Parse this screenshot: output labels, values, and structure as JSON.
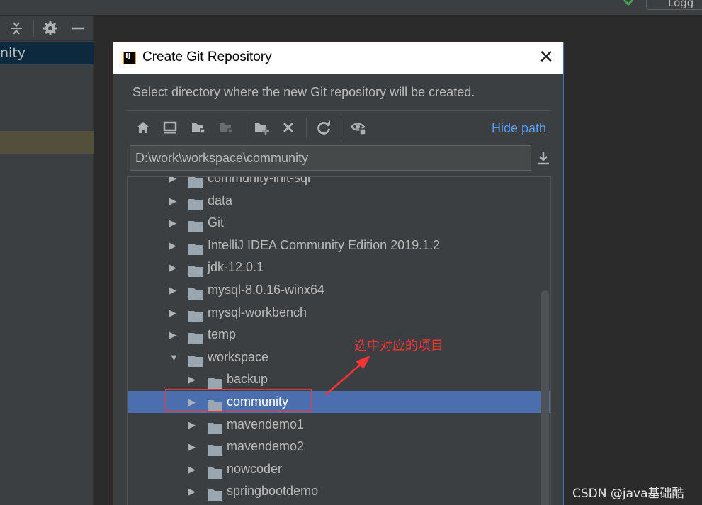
{
  "background": {
    "logger_label": "Logg",
    "left_panel_selected": "nity"
  },
  "dialog": {
    "title": "Create Git Repository",
    "description": "Select directory where the new Git repository will be created.",
    "hide_path_label": "Hide path",
    "path_value": "D:\\work\\workspace\\community",
    "toolbar_icons": [
      "home-icon",
      "desktop-icon",
      "project-folder-icon",
      "module-folder-icon",
      "new-folder-icon",
      "delete-icon",
      "refresh-icon",
      "show-hidden-icon"
    ],
    "tree": [
      {
        "label": "community-init-sql",
        "depth": 0,
        "expanded": false,
        "selected": false
      },
      {
        "label": "data",
        "depth": 0,
        "expanded": false,
        "selected": false
      },
      {
        "label": "Git",
        "depth": 0,
        "expanded": false,
        "selected": false
      },
      {
        "label": "IntelliJ IDEA Community Edition 2019.1.2",
        "depth": 0,
        "expanded": false,
        "selected": false
      },
      {
        "label": "jdk-12.0.1",
        "depth": 0,
        "expanded": false,
        "selected": false
      },
      {
        "label": "mysql-8.0.16-winx64",
        "depth": 0,
        "expanded": false,
        "selected": false
      },
      {
        "label": "mysql-workbench",
        "depth": 0,
        "expanded": false,
        "selected": false
      },
      {
        "label": "temp",
        "depth": 0,
        "expanded": false,
        "selected": false
      },
      {
        "label": "workspace",
        "depth": 0,
        "expanded": true,
        "selected": false
      },
      {
        "label": "backup",
        "depth": 1,
        "expanded": false,
        "selected": false
      },
      {
        "label": "community",
        "depth": 1,
        "expanded": false,
        "selected": true
      },
      {
        "label": "mavendemo1",
        "depth": 1,
        "expanded": false,
        "selected": false
      },
      {
        "label": "mavendemo2",
        "depth": 1,
        "expanded": false,
        "selected": false
      },
      {
        "label": "nowcoder",
        "depth": 1,
        "expanded": false,
        "selected": false
      },
      {
        "label": "springbootdemo",
        "depth": 1,
        "expanded": false,
        "selected": false
      }
    ]
  },
  "annotation": {
    "text": "选中对应的项目",
    "color": "#ff3333"
  },
  "watermark": "CSDN @java基础酷",
  "colors": {
    "selection": "#4b6eaf",
    "link": "#589df6",
    "dialog_bg": "#3c3f41"
  }
}
